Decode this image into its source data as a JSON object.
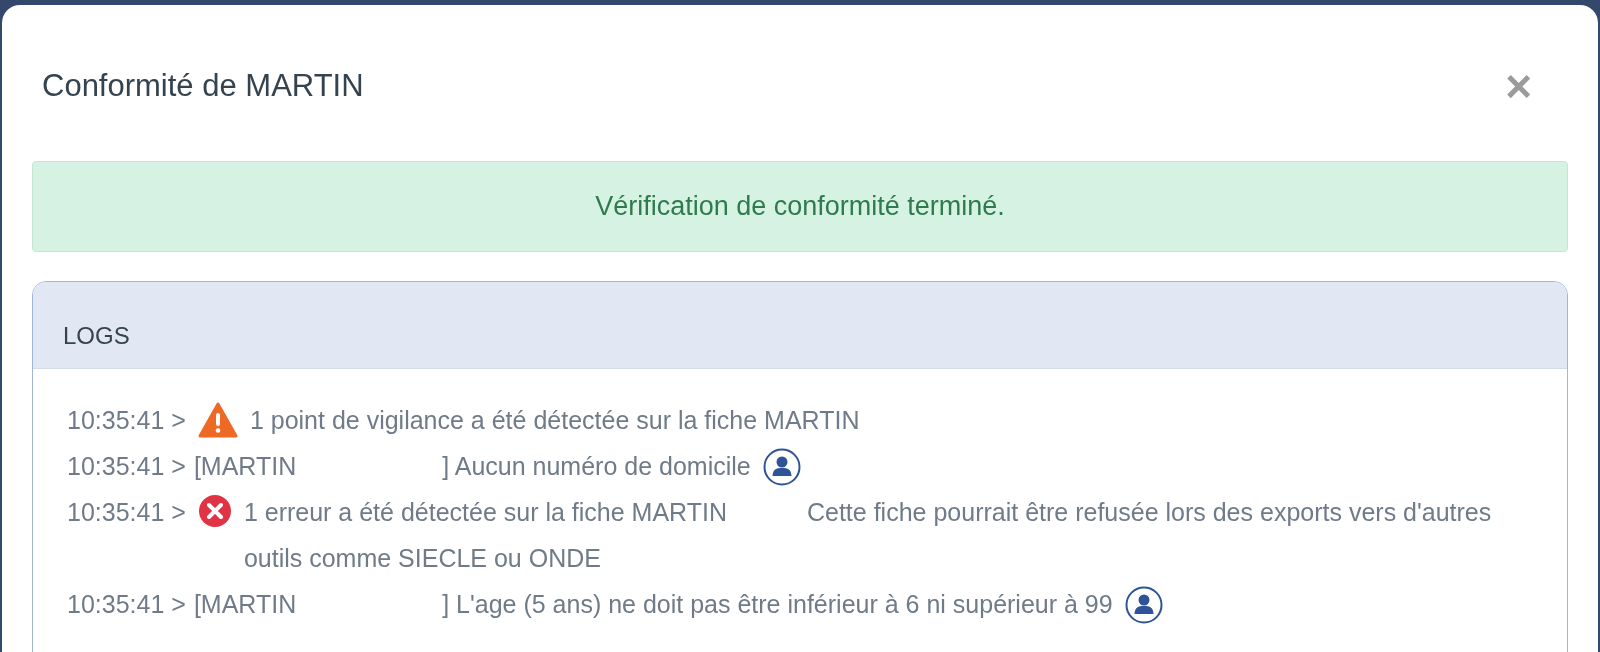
{
  "modal": {
    "title": "Conformité de MARTIN",
    "close": "×"
  },
  "alert": {
    "text": "Vérification de conformité terminé."
  },
  "logs": {
    "title": "LOGS",
    "entries": [
      {
        "time": "10:35:41 >",
        "kind": "warning",
        "text": "1 point de vigilance a été détectée sur la fiche MARTIN"
      },
      {
        "time": "10:35:41 >",
        "kind": "record",
        "name": "[MARTIN",
        "text": "] Aucun numéro de domicile",
        "user_link": true
      },
      {
        "time": "10:35:41 >",
        "kind": "error",
        "text": "1 erreur a été détectée sur la fiche MARTIN",
        "note": "Cette fiche pourrait être refusée lors des exports vers d'autres outils comme SIECLE ou ONDE"
      },
      {
        "time": "10:35:41 >",
        "kind": "record",
        "name": "[MARTIN",
        "text": "] L'age (5 ans) ne doit pas être inférieur à 6 ni supérieur à 99",
        "user_link": true
      }
    ]
  }
}
